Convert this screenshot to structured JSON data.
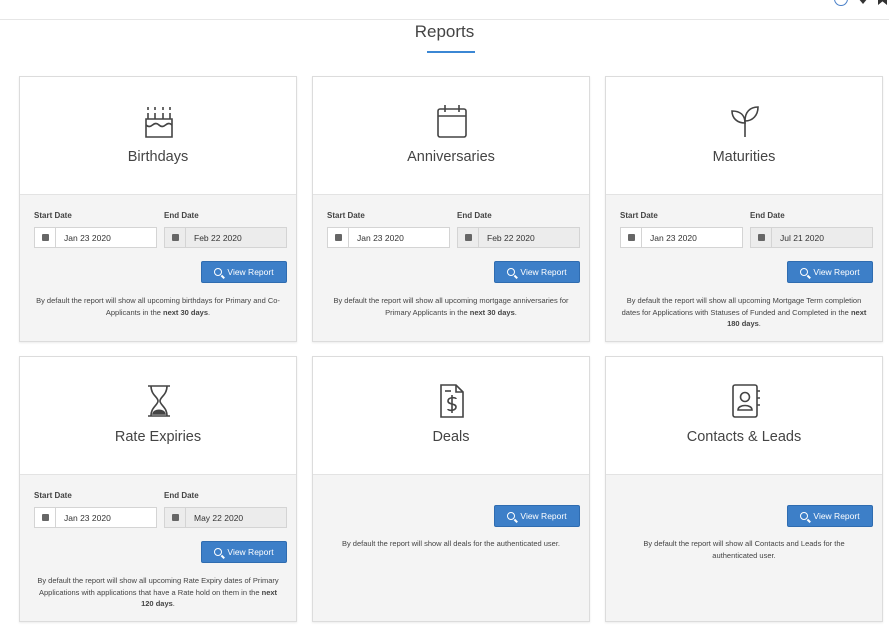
{
  "page_title": "Reports",
  "labels": {
    "start": "Start Date",
    "end": "End Date",
    "view": "View Report"
  },
  "cards": [
    {
      "title": "Birthdays",
      "start": "Jan 23 2020",
      "end": "Feb 22 2020",
      "desc_pre": "By default the report will show all upcoming birthdays for Primary and Co-Applicants in the ",
      "desc_bold": "next 30 days",
      "desc_post": "."
    },
    {
      "title": "Anniversaries",
      "start": "Jan 23 2020",
      "end": "Feb 22 2020",
      "desc_pre": "By default the report will show all upcoming mortgage anniversaries for Primary Applicants in the ",
      "desc_bold": "next 30 days",
      "desc_post": "."
    },
    {
      "title": "Maturities",
      "start": "Jan 23 2020",
      "end": "Jul 21 2020",
      "desc_pre": "By default the report will show all upcoming Mortgage Term completion dates for Applications with Statuses of Funded and Completed in the ",
      "desc_bold": "next 180 days",
      "desc_post": "."
    },
    {
      "title": "Rate Expiries",
      "start": "Jan 23 2020",
      "end": "May 22 2020",
      "desc_pre": "By default the report will show all upcoming Rate Expiry dates of Primary Applications with applications that have a Rate hold on them in the ",
      "desc_bold": "next 120 days",
      "desc_post": "."
    },
    {
      "title": "Deals",
      "desc_pre": "By default the report will show all deals for the authenticated user."
    },
    {
      "title": "Contacts & Leads",
      "desc_pre": "By default the report will show all Contacts and Leads for the authenticated user."
    }
  ]
}
